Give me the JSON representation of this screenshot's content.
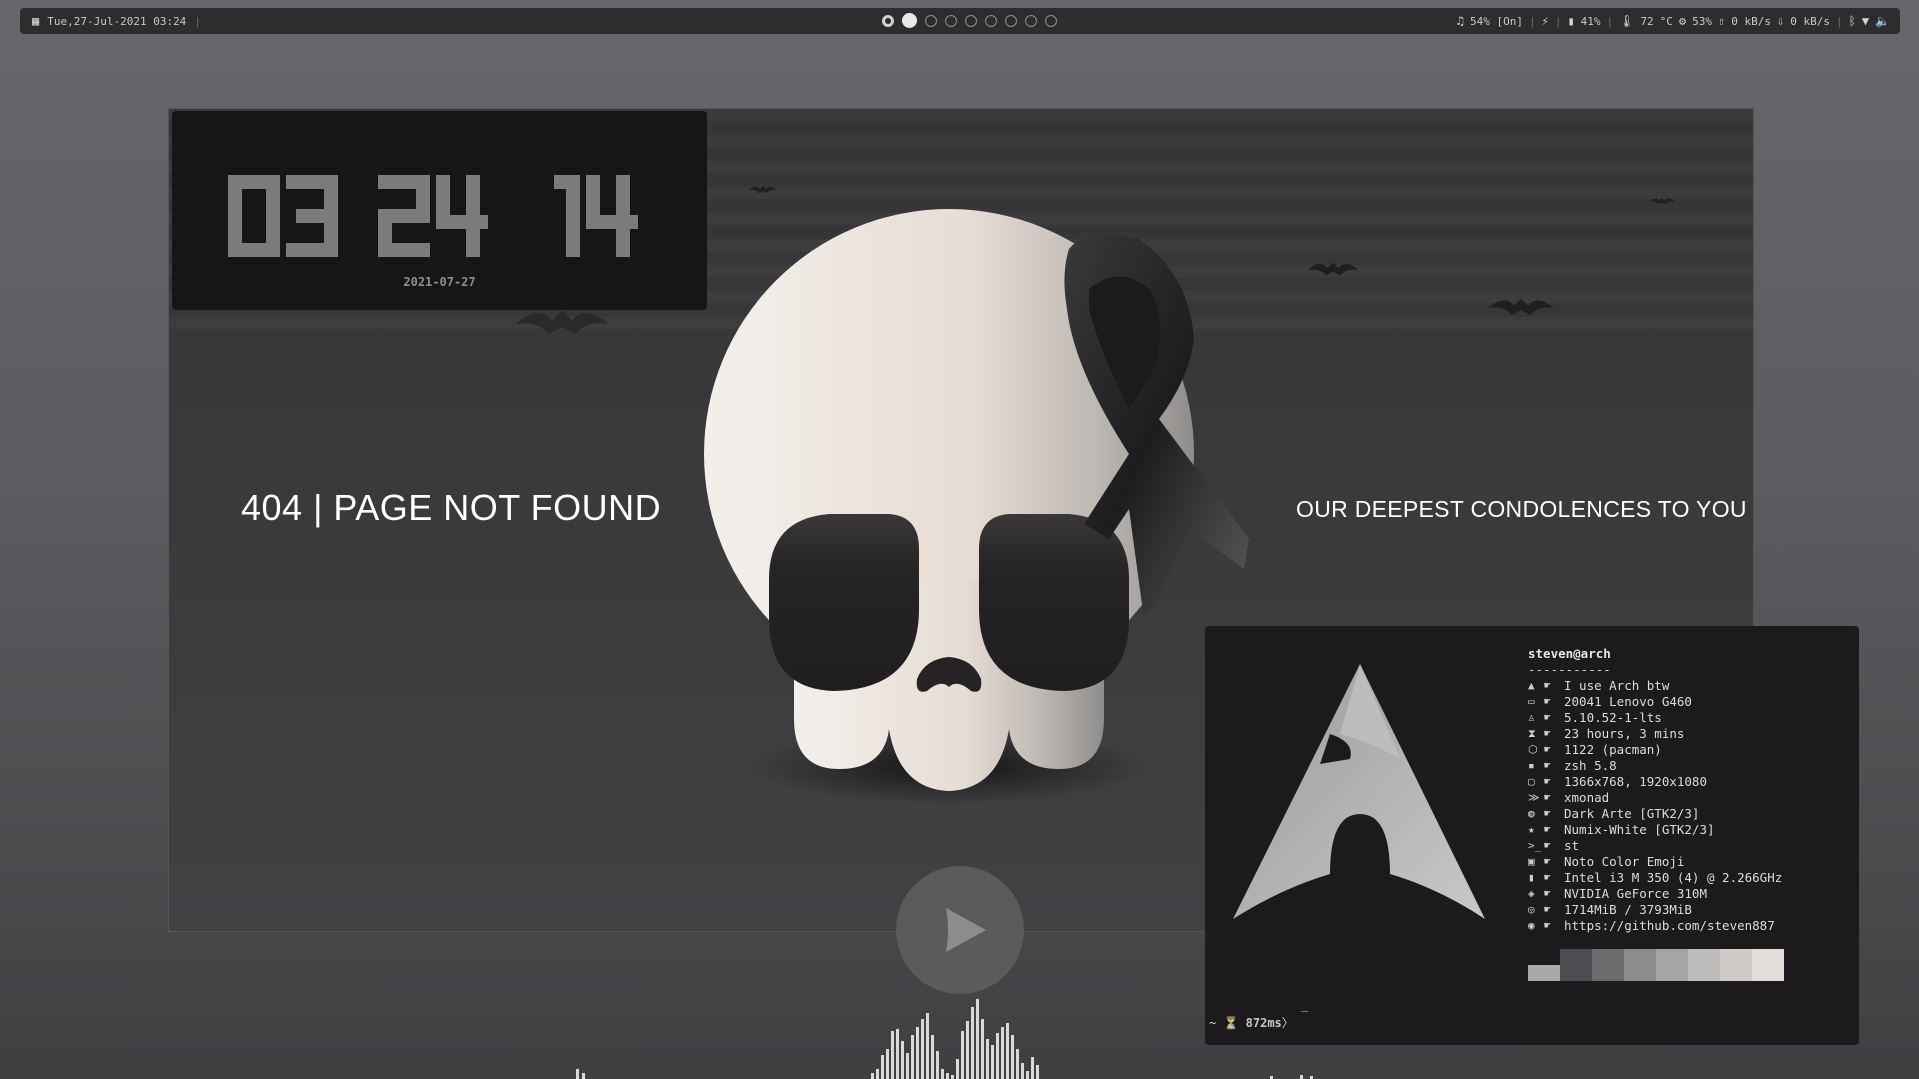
{
  "topbar": {
    "datetime": "Tue,27-Jul-2021 03:24",
    "separator": "|",
    "workspaces": [
      "occupied",
      "current",
      "empty",
      "empty",
      "empty",
      "empty",
      "empty",
      "empty",
      "empty"
    ],
    "volume": "54% [On]",
    "battery": "41%",
    "temperature_value": "72",
    "temperature_unit": "°C",
    "cpu": "53%",
    "upload": "0 kB/s",
    "download": "0 kB/s"
  },
  "clock": {
    "hours": "03",
    "minutes": "24",
    "seconds": "14",
    "date": "2021-07-27"
  },
  "wallpaper": {
    "left_text": "404 | PAGE NOT FOUND",
    "right_text": "OUR DEEPEST CONDOLENCES TO YOU"
  },
  "terminal": {
    "user": "steven@arch",
    "divider": "-----------",
    "rows": [
      {
        "icon": "arch-icon",
        "glyph": "▲",
        "value": "I use Arch btw"
      },
      {
        "icon": "laptop-icon",
        "glyph": "▭",
        "value": "20041 Lenovo G460"
      },
      {
        "icon": "tux-icon",
        "glyph": "♙",
        "value": "5.10.52-1-lts"
      },
      {
        "icon": "hourglass-icon",
        "glyph": "⧗",
        "value": "23 hours, 3 mins"
      },
      {
        "icon": "package-icon",
        "glyph": "⬡",
        "value": "1122 (pacman)"
      },
      {
        "icon": "shell-icon",
        "glyph": "▪",
        "value": "zsh 5.8"
      },
      {
        "icon": "monitor-icon",
        "glyph": "▢",
        "value": "1366x768, 1920x1080"
      },
      {
        "icon": "wm-icon",
        "glyph": "≫",
        "value": "xmonad"
      },
      {
        "icon": "palette-icon",
        "glyph": "◍",
        "value": "Dark Arte [GTK2/3]"
      },
      {
        "icon": "star-icon",
        "glyph": "★",
        "value": "Numix-White [GTK2/3]"
      },
      {
        "icon": "terminal-icon",
        "glyph": ">_",
        "value": "st"
      },
      {
        "icon": "font-icon",
        "glyph": "▣",
        "value": "Noto Color Emoji"
      },
      {
        "icon": "cpu-icon",
        "glyph": "▮",
        "value": "Intel i3 M 350 (4) @ 2.266GHz"
      },
      {
        "icon": "gpu-icon",
        "glyph": "◈",
        "value": "NVIDIA GeForce 310M"
      },
      {
        "icon": "memory-icon",
        "glyph": "◎",
        "value": "1714MiB / 3793MiB"
      },
      {
        "icon": "github-icon",
        "glyph": "◉",
        "value": "https://github.com/steven887"
      }
    ],
    "row_hand_glyph": "☛",
    "palette_colors": [
      "#a9a9a9",
      "#4d4c50",
      "#6b6a6d",
      "#8d8c8e",
      "#a6a5a6",
      "#bdbbbb",
      "#cfcbc7",
      "#e2ddd8"
    ],
    "prompt_tilde": "~",
    "prompt_time": "872ms",
    "prompt_arrow": "〉",
    "cursor": "‾"
  },
  "colors": {
    "topbar_bg": "#2d2c2f",
    "wallpaper_bg": "#3a393b",
    "skull": "#ece6df",
    "clock_digit": "#7c7a7b",
    "terminal_bg": "#1c1a1c"
  }
}
